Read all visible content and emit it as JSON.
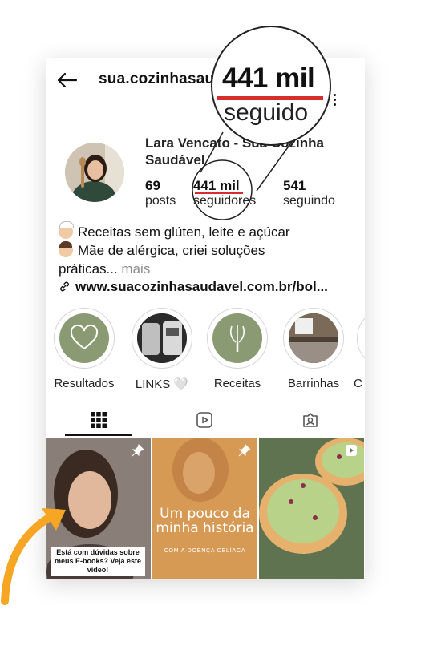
{
  "header": {
    "username": "sua.cozinhasaudavel"
  },
  "profile": {
    "name": "Lara Vencato - Sua Cozinha Saudável",
    "stats": {
      "posts_value": "69",
      "posts_label": "posts",
      "followers_value": "441 mil",
      "followers_label": "seguidores",
      "following_value": "541",
      "following_label": "seguindo"
    },
    "bio": {
      "line1": "Receitas sem glúten, leite e açúcar",
      "line2": "Mãe de alérgica, criei soluções",
      "line3_text": "práticas...",
      "line3_more": " mais",
      "link": "www.suacozinhasaudavel.com.br/bol..."
    }
  },
  "highlights": [
    {
      "label": "Resultados",
      "icon": "heart-icon"
    },
    {
      "label": "LINKS 🤍",
      "icon": "air-fryer-photo"
    },
    {
      "label": "Receitas",
      "icon": "whisk-icon"
    },
    {
      "label": "Barrinhas",
      "icon": "kitchen-photo"
    },
    {
      "label": "C"
    }
  ],
  "tabs": [
    "grid-icon",
    "reels-icon",
    "tagged-icon"
  ],
  "posts": {
    "post1_caption": "Está com dúvidas sobre meus E-books? Veja este vídeo!",
    "post2_title": "Um pouco da minha história",
    "post2_subtitle": "COM A DOENÇA CELÍACA"
  },
  "zoom": {
    "number": "441 mil",
    "label": "seguido"
  },
  "colors": {
    "accent_underline": "#d62e2e",
    "highlight_green": "#8a9a72",
    "arrow_orange": "#f6a623"
  }
}
